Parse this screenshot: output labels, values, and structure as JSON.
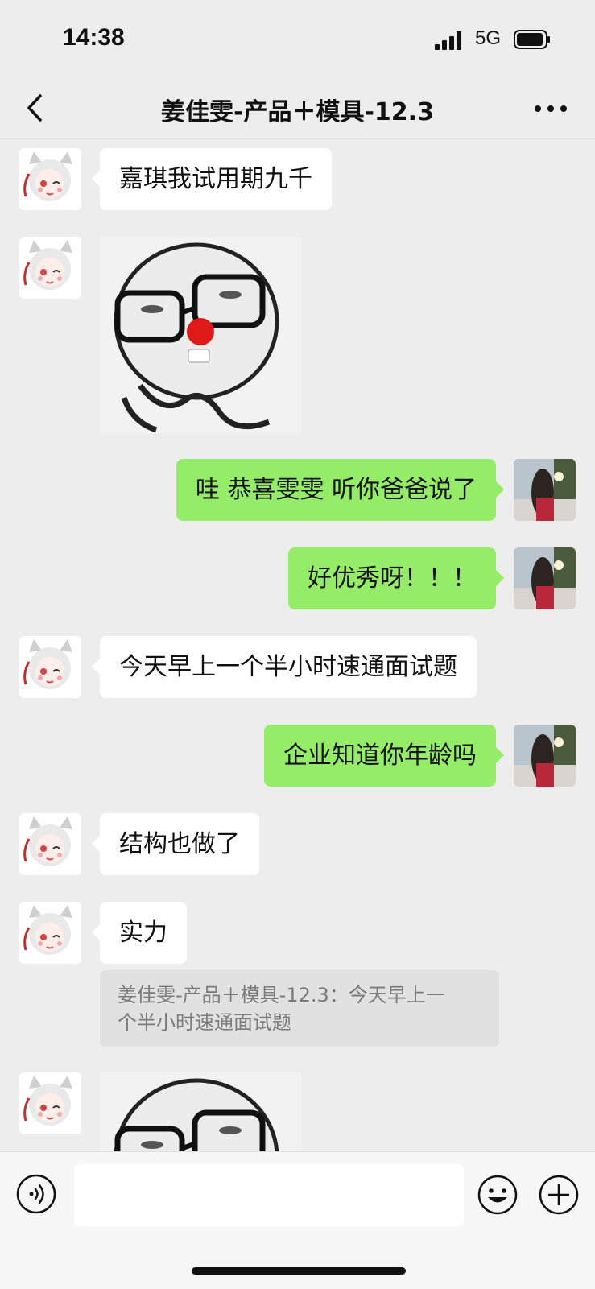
{
  "status": {
    "time": "14:38",
    "network": "5G"
  },
  "header": {
    "title": "姜佳雯-产品＋模具-12.3"
  },
  "messages": [
    {
      "side": "left",
      "type": "text",
      "text": "嘉琪我试用期九千"
    },
    {
      "side": "left",
      "type": "sticker"
    },
    {
      "side": "right",
      "type": "text",
      "text": "哇 恭喜雯雯  听你爸爸说了"
    },
    {
      "side": "right",
      "type": "text",
      "text": "好优秀呀！！！"
    },
    {
      "side": "left",
      "type": "text",
      "text": "今天早上一个半小时速通面试题"
    },
    {
      "side": "right",
      "type": "text",
      "text": "企业知道你年龄吗"
    },
    {
      "side": "left",
      "type": "text",
      "text": "结构也做了"
    },
    {
      "side": "left",
      "type": "text",
      "text": "实力"
    },
    {
      "side": "left",
      "type": "sticker"
    }
  ],
  "quote": {
    "line1": "姜佳雯-产品＋模具-12.3：今天早上一",
    "line2": "个半小时速通面试题"
  },
  "icons": {
    "back": "chevron-left-icon",
    "more": "more-horizontal-icon",
    "voice": "voice-icon",
    "emoji": "emoji-icon",
    "plus": "plus-icon"
  },
  "colors": {
    "sent_bubble": "#95ec69",
    "received_bubble": "#ffffff",
    "background": "#ededed"
  }
}
